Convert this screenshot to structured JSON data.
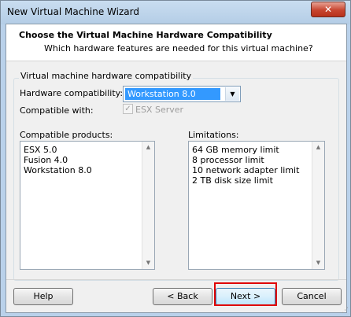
{
  "window": {
    "title": "New Virtual Machine Wizard",
    "close_glyph": "✕"
  },
  "header": {
    "title": "Choose the Virtual Machine Hardware Compatibility",
    "subtitle": "Which hardware features are needed for this virtual machine?"
  },
  "group": {
    "legend": "Virtual machine hardware compatibility",
    "hardware_label": "Hardware compatibility:",
    "hardware_value": "Workstation 8.0",
    "compatible_with_label": "Compatible with:",
    "esx_server_label": "ESX Server",
    "esx_server_checked": true,
    "esx_server_enabled": false
  },
  "products": {
    "label": "Compatible products:",
    "items": [
      "ESX 5.0",
      "Fusion 4.0",
      "Workstation 8.0"
    ]
  },
  "limitations": {
    "label": "Limitations:",
    "items": [
      "64 GB memory limit",
      "8 processor limit",
      "10 network adapter limit",
      "2 TB disk size limit"
    ]
  },
  "buttons": {
    "help": "Help",
    "back": "< Back",
    "next": "Next >",
    "cancel": "Cancel"
  },
  "colors": {
    "highlight": "#e00000",
    "selection": "#3399ff"
  }
}
